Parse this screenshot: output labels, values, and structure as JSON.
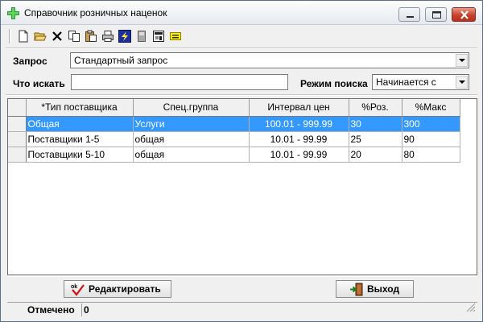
{
  "window": {
    "title": "Справочник розничных наценок"
  },
  "toolbar": {
    "buttons": [
      {
        "icon": "new-document-icon"
      },
      {
        "icon": "open-folder-icon"
      },
      {
        "icon": "delete-icon"
      },
      {
        "icon": "copy-icon"
      },
      {
        "icon": "paste-icon"
      },
      {
        "icon": "print-icon"
      },
      {
        "icon": "lightning-icon"
      },
      {
        "icon": "disk-icon"
      },
      {
        "icon": "form-icon"
      },
      {
        "icon": "note-icon"
      }
    ]
  },
  "query": {
    "label": "Запрос",
    "value": "Стандартный запрос"
  },
  "search": {
    "label": "Что искать",
    "value": ""
  },
  "search_mode": {
    "label": "Режим поиска",
    "value": "Начинается с"
  },
  "grid": {
    "columns": [
      "*Тип поставщика",
      "Спец.группа",
      "Интервал цен",
      "%Роз.",
      "%Макс"
    ],
    "rows": [
      [
        "Общая",
        "Услуги",
        "100.01 - 999.99",
        "30",
        "300"
      ],
      [
        "Поставщики 1-5",
        "общая",
        "10.01 - 99.99",
        "25",
        "90"
      ],
      [
        "Поставщики 5-10",
        "общая",
        "10.01 - 99.99",
        "20",
        "80"
      ]
    ],
    "selected_row": 0
  },
  "buttons": {
    "edit_label": "Редактировать",
    "exit_label": "Выход"
  },
  "status": {
    "marked_label": "Отмечено",
    "marked_value": "0"
  },
  "colors": {
    "selection": "#3399ff",
    "close_button": "#c8412b"
  }
}
